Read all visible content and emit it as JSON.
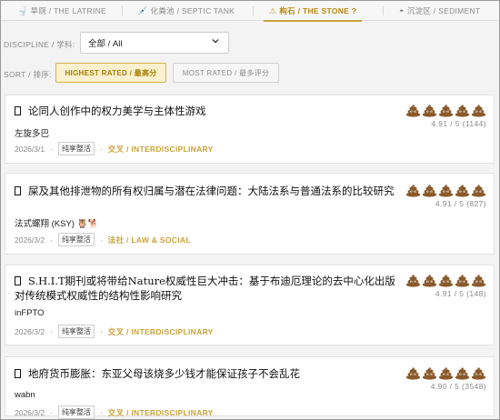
{
  "tabs": [
    {
      "icon": "toilet-icon",
      "glyph": "🚽",
      "label": "旱厕 / THE LATRINE"
    },
    {
      "icon": "syringe-icon",
      "glyph": "💉",
      "label": "化粪池 / SEPTIC TANK"
    },
    {
      "icon": "warning-icon",
      "glyph": "⚠",
      "label": "构石 / THE STONE ?"
    },
    {
      "icon": "sediment-icon",
      "glyph": "◓",
      "label": "沉淀区 / SEDIMENT"
    }
  ],
  "filters": {
    "discipline_label": "DISCIPLINE / 学科:",
    "discipline_value": "全部 / All",
    "sort_label": "SORT / 排序:",
    "sort_highest": "HIGHEST RATED / 最高分",
    "sort_most": "MOST RATED / 最多评分"
  },
  "colors": {
    "accent": "#c9a23a",
    "poop": "#8b5a2b"
  },
  "papers": [
    {
      "title": "论同人创作中的权力美学与主体性游戏",
      "author": "左旋多巴",
      "date": "2026/3/1",
      "tag": "纯享整活",
      "category": "交叉 / INTERDISCIPLINARY",
      "score": "4.91 / 5  (1144)",
      "rating": 5
    },
    {
      "title": "屎及其他排泄物的所有权归属与潜在法律问题：大陆法系与普通法系的比较研究",
      "author": "法式螺翔 (KSY) 🦉🐕",
      "date": "2026/3/2",
      "tag": "纯享整活",
      "category": "法社 / LAW & SOCIAL",
      "score": "4.91 / 5  (827)",
      "rating": 5
    },
    {
      "title": "S.H.I.T期刊或将带给Nature权威性巨大冲击：基于布迪厄理论的去中心化出版对传统模式权威性的结构性影响研究",
      "author": "inFPTO",
      "date": "2026/3/2",
      "tag": "纯享整活",
      "category": "交叉 / INTERDISCIPLINARY",
      "score": "4.91 / 5  (148)",
      "rating": 5
    },
    {
      "title": "地府货币膨胀：东亚父母该烧多少钱才能保证孩子不会乱花",
      "author": "wabn",
      "date": "2026/3/2",
      "tag": "纯享整活",
      "category": "交叉 / INTERDISCIPLINARY",
      "score": "4.90 / 5  (3548)",
      "rating": 5
    }
  ]
}
